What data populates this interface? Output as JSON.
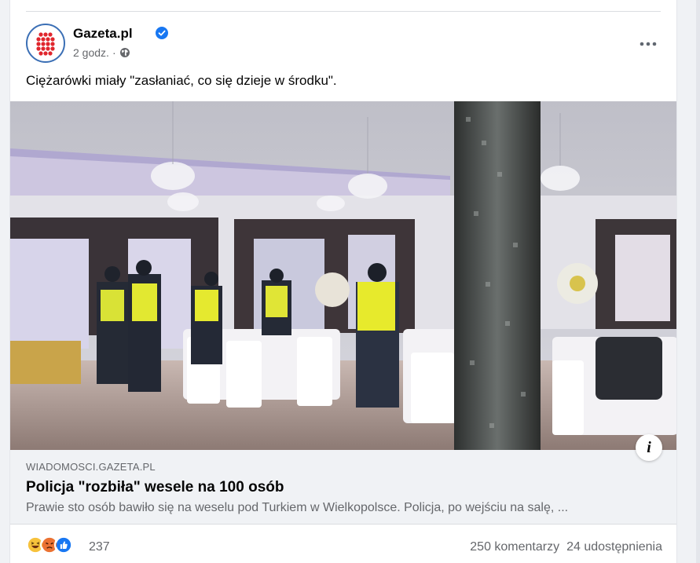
{
  "post": {
    "page_name": "Gazeta.pl",
    "time": "2 godz.",
    "separator": "·",
    "text": "Ciężarówki miały \"zasłaniać, co się dzieje w środku\".",
    "verified_color": "#1877f2",
    "brand_color": "#e0262d"
  },
  "link": {
    "domain": "WIADOMOSCI.GAZETA.PL",
    "title": "Policja \"rozbiła\" wesele na 100 osób",
    "description": "Prawie sto osób bawiło się na weselu pod Turkiem w Wielkopolsce. Policja, po wejściu na salę, ..."
  },
  "engagement": {
    "reaction_icons": [
      "haha-icon",
      "angry-icon",
      "like-icon"
    ],
    "reaction_count": "237",
    "comments": "250 komentarzy",
    "shares": "24 udostępnienia"
  },
  "icons": {
    "more": "more-options-icon",
    "info": "info-icon",
    "globe": "globe-icon"
  }
}
